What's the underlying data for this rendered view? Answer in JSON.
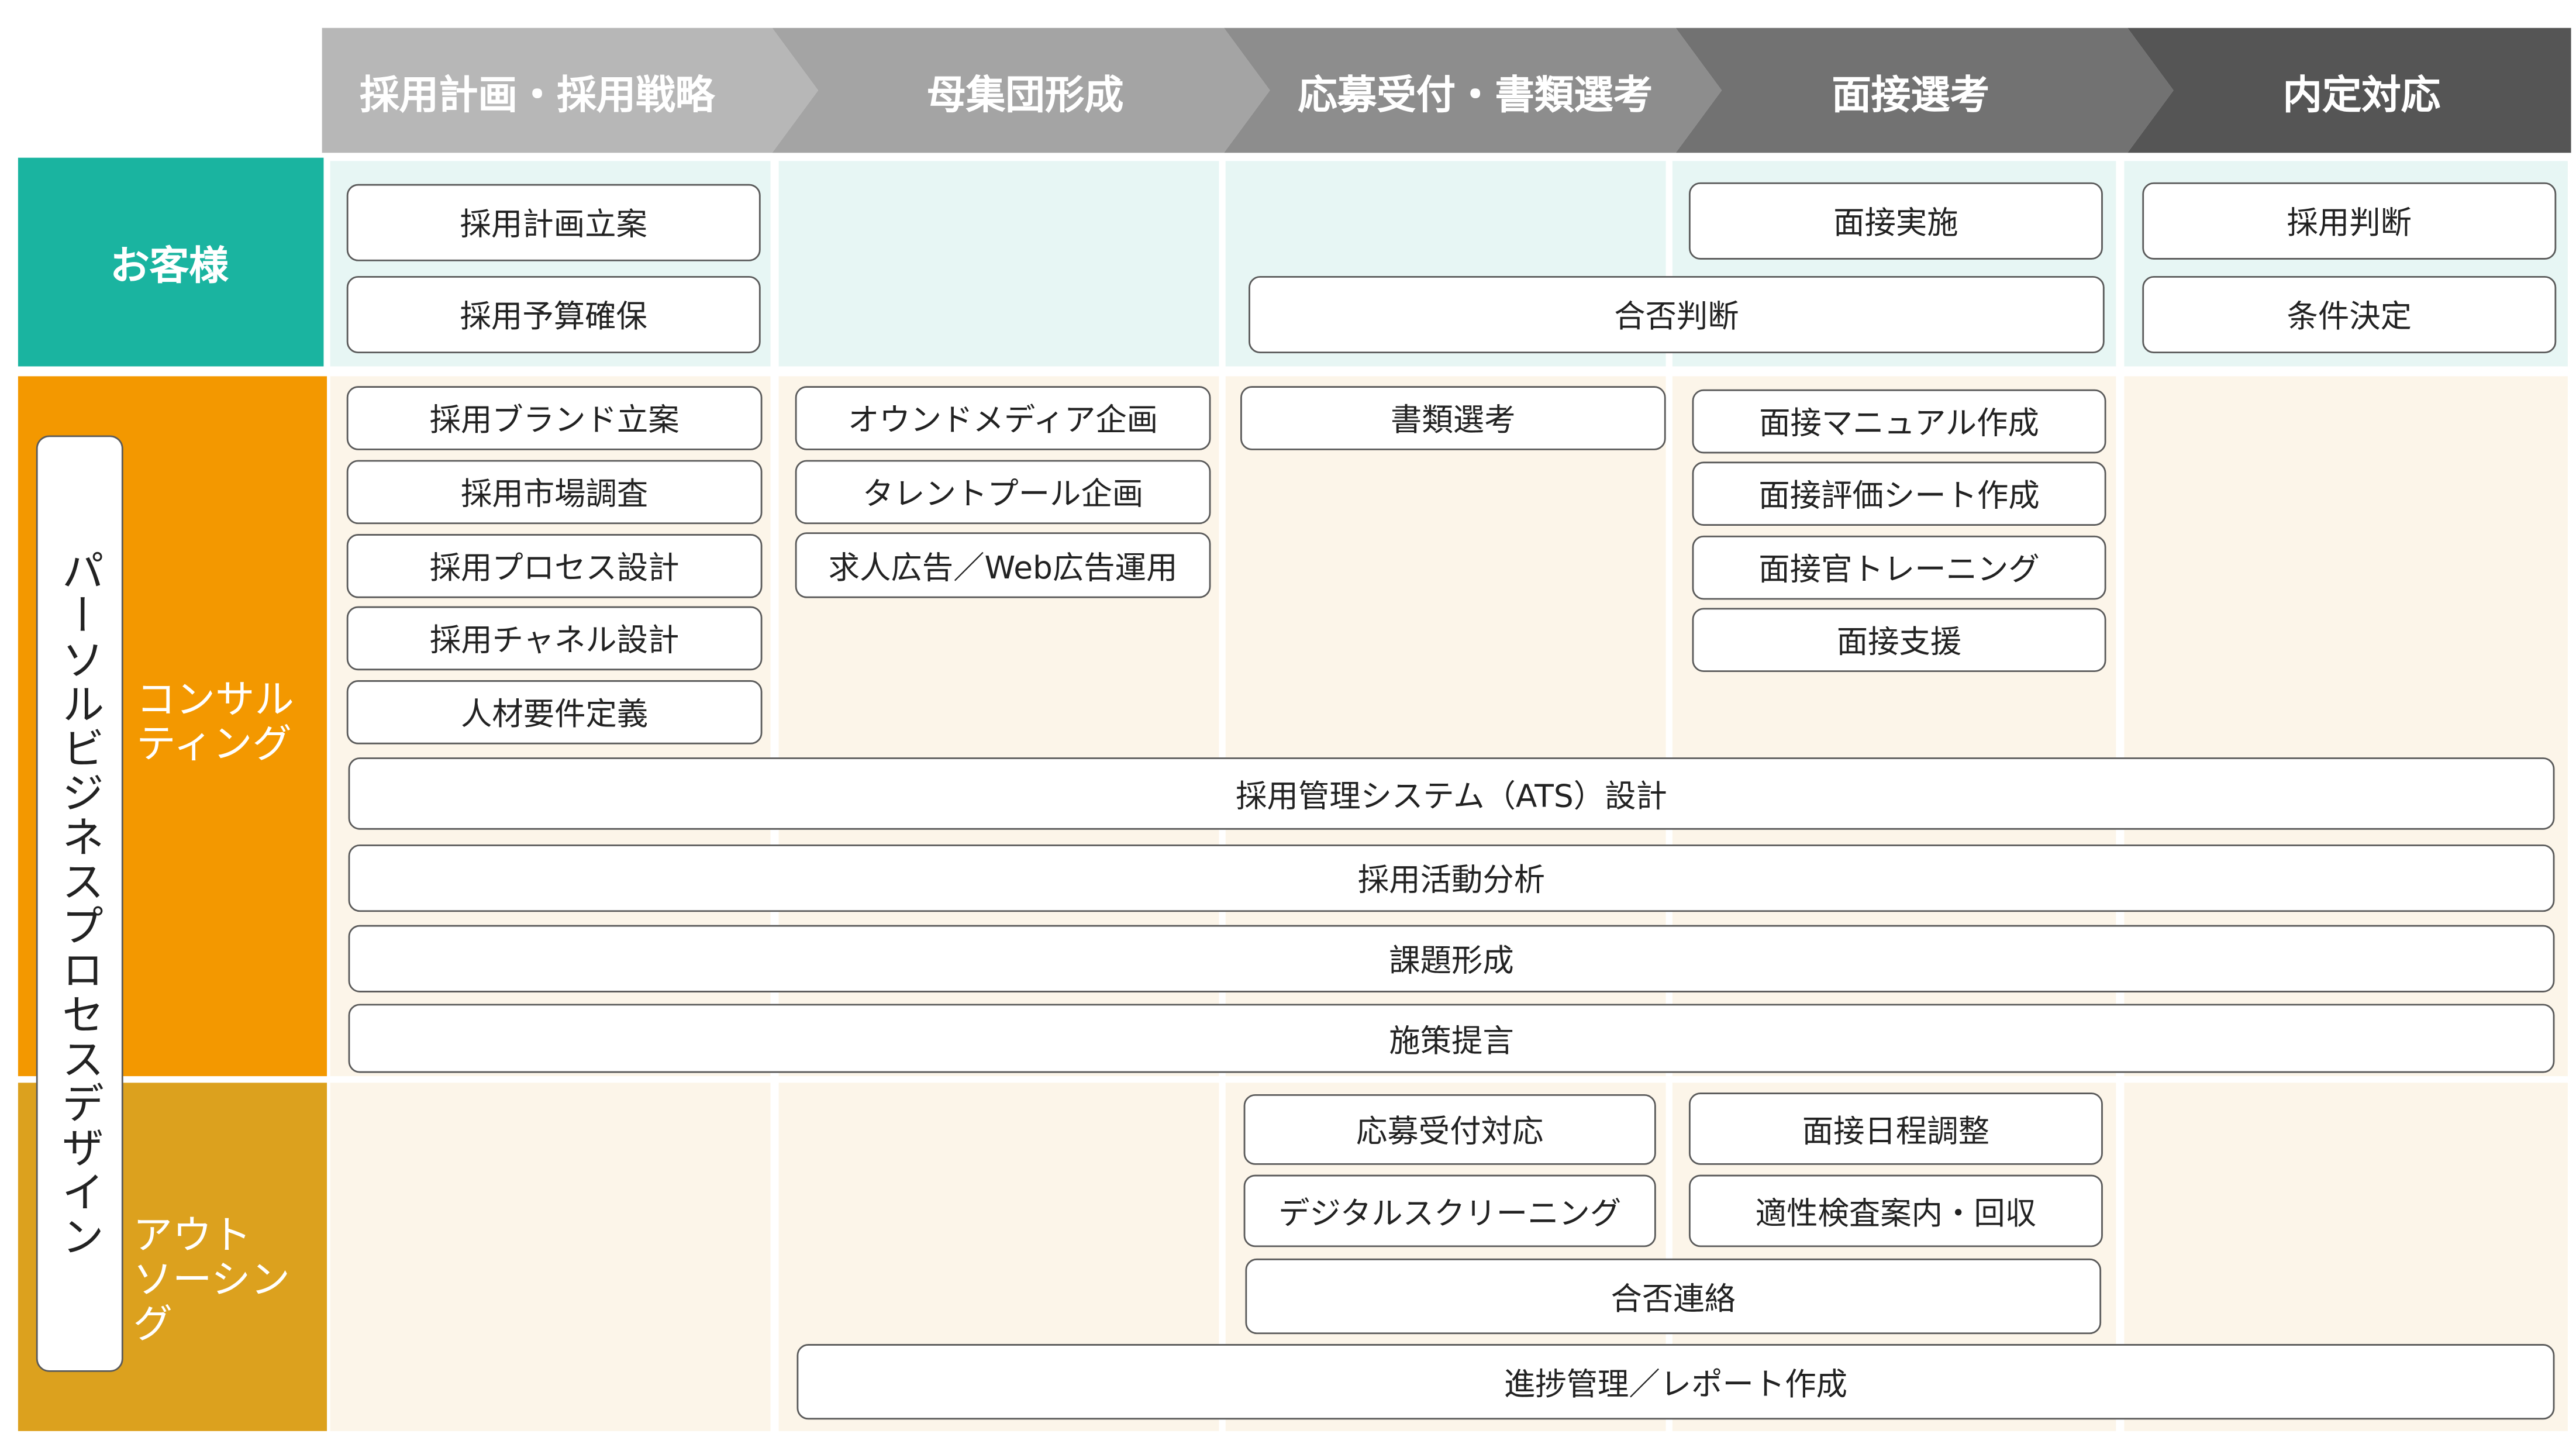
{
  "phases": [
    "採用計画・採用戦略",
    "母集団形成",
    "応募受付・書類選考",
    "面接選考",
    "内定対応"
  ],
  "rows": {
    "customer": "お客様",
    "process_design": "パーソルビジネスプロセスデザイン",
    "consulting": [
      "コンサル",
      "ティング"
    ],
    "outsourcing": [
      "アウト",
      "ソーシング"
    ]
  },
  "tasks": {
    "customer": [
      "採用計画立案",
      "採用予算確保",
      "面接実施",
      "合否判断",
      "採用判断",
      "条件決定"
    ],
    "consulting": [
      "採用ブランド立案",
      "採用市場調査",
      "採用プロセス設計",
      "採用チャネル設計",
      "人材要件定義",
      "オウンドメディア企画",
      "タレントプール企画",
      "求人広告／Web広告運用",
      "書類選考",
      "面接マニュアル作成",
      "面接評価シート作成",
      "面接官トレーニング",
      "面接支援",
      "採用管理システム（ATS）設計",
      "採用活動分析",
      "課題形成",
      "施策提言"
    ],
    "outsourcing": [
      "応募受付対応",
      "デジタルスクリーニング",
      "面接日程調整",
      "適性検査案内・回収",
      "合否連絡",
      "進捗管理／レポート作成"
    ]
  },
  "colors": {
    "header": [
      "#b7b7b7",
      "#a4a4a4",
      "#8d8d8d",
      "#727272",
      "#555555"
    ],
    "customer": "#1ab4a0",
    "customer_cell": "#e7f6f4",
    "consulting": "#f39800",
    "outsourcing": "#dca11e",
    "lower_cell": "#fcf5e9"
  }
}
